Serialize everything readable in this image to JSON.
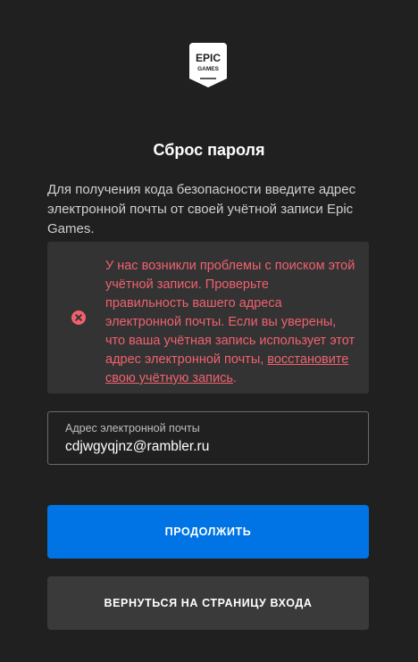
{
  "logo": {
    "line1": "EPIC",
    "line2": "GAMES",
    "icon": "epic-games-logo"
  },
  "page": {
    "title": "Сброс пароля",
    "description": "Для получения кода безопасности введите адрес электронной почты от своей учётной записи Epic Games."
  },
  "error": {
    "icon": "error-x-circle",
    "message": "У нас возникли проблемы с поиском этой учётной записи. Проверьте правильность вашего адреса электронной почты. Если вы уверены, что ваша учётная запись использует этот адрес электронной почты,",
    "link_label": "восстановите свою учётную запись",
    "trailing": ".",
    "color": "#f0616e",
    "background": "#333333"
  },
  "email": {
    "label": "Адрес электронной почты",
    "value": "cdjwgyqjnz@rambler.ru"
  },
  "buttons": {
    "continue_label": "ПРОДОЛЖИТЬ",
    "back_label": "ВЕРНУТЬСЯ НА СТРАНИЦУ ВХОДА"
  },
  "colors": {
    "background": "#202020",
    "primary": "#0074e4",
    "secondary_button": "#3a3a3a"
  }
}
